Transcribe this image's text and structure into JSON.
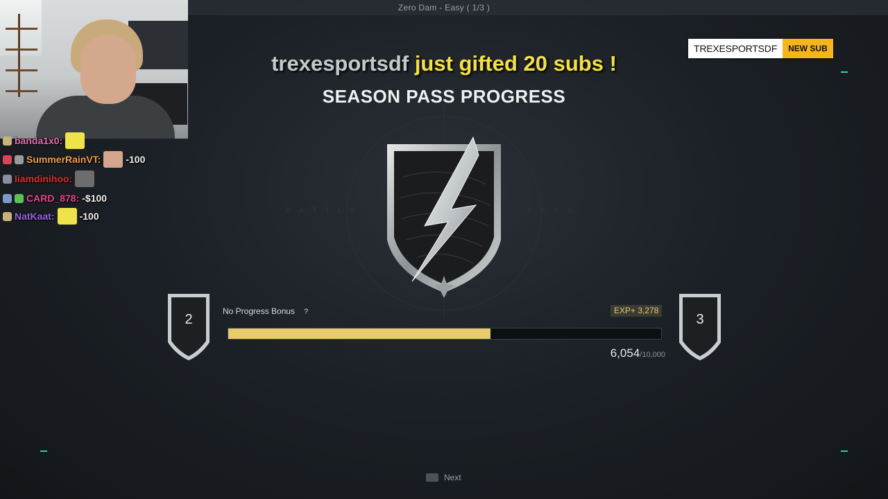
{
  "game": {
    "mode_title": "Zero Dam - Easy ( 1/3 )"
  },
  "alert": {
    "username": "trexesportsdf",
    "message": "just gifted 20 subs !"
  },
  "sub_badge": {
    "name": "TREXESPORTSDF",
    "tag": "NEW SUB"
  },
  "season_pass": {
    "title": "SEASON PASS PROGRESS",
    "watermark_left": "BATTLE",
    "watermark_right": "PASS",
    "current_rank": "2",
    "next_rank": "3",
    "bonus_label": "No Progress Bonus",
    "help_glyph": "?",
    "exp_gain": "EXP+ 3,278",
    "progress_current": "6,054",
    "progress_max": "/10,000",
    "progress_fraction": 0.6054,
    "accent_color": "#e8cc6b"
  },
  "chat": [
    {
      "user": "banda1x0:",
      "color": "#e86fb0",
      "message": "",
      "badge_colors": [
        "#c9b17a"
      ],
      "has_emote": true
    },
    {
      "user": "SummerRainVT:",
      "color": "#f0a14a",
      "message": "-100",
      "badge_colors": [
        "#d8455a",
        "#9a9a9a"
      ],
      "has_emote": true
    },
    {
      "user": "liamdinihoo:",
      "color": "#e0302c",
      "message": "",
      "badge_colors": [
        "#8a8ea0"
      ],
      "has_emote": true
    },
    {
      "user": "CARD_878:",
      "color": "#e94690",
      "message": "-$100",
      "badge_colors": [
        "#7a9ac9",
        "#5bc255"
      ],
      "has_emote": false
    },
    {
      "user": "NatKaat:",
      "color": "#9b63e8",
      "message": "-100",
      "badge_colors": [
        "#c9b17a"
      ],
      "has_emote": true
    }
  ],
  "footer": {
    "next_label": "Next"
  }
}
